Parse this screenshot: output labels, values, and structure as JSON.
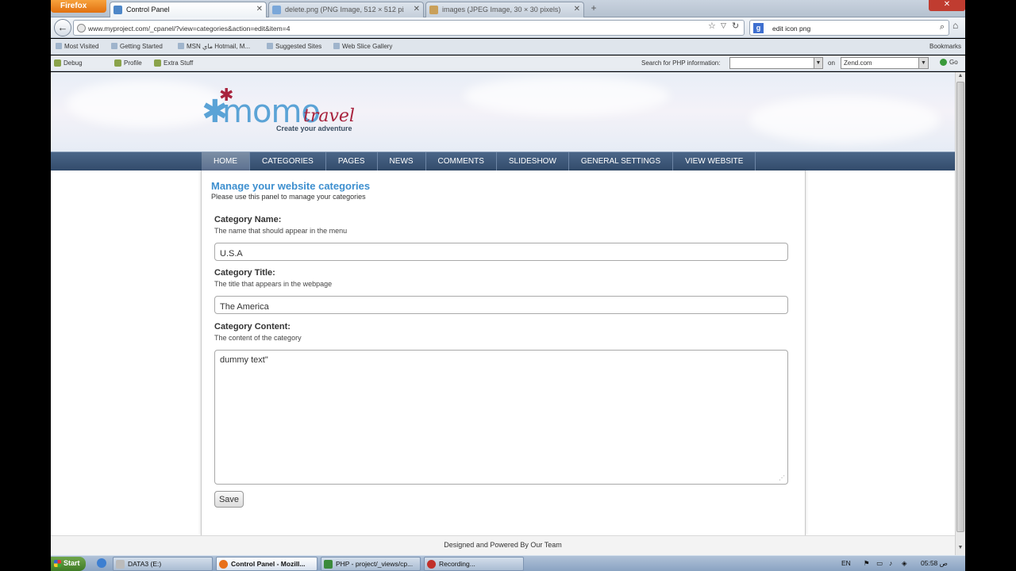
{
  "browser": {
    "menu_button": "Firefox",
    "tabs": [
      {
        "label": "Control Panel",
        "active": true
      },
      {
        "label": "delete.png (PNG Image, 512 × 512 pixels)",
        "active": false
      },
      {
        "label": "images (JPEG Image, 30 × 30 pixels)",
        "active": false
      }
    ],
    "url": "www.myproject.com/_cpanel/?view=categories&action=edit&item=4",
    "search_value": "edit icon png",
    "search_engine_letter": "g",
    "bookmarks": [
      "Most Visited",
      "Getting Started",
      "MSN ماي Hotmail, M...",
      "Suggested Sites",
      "Web Slice Gallery"
    ],
    "bookmarks_menu": "Bookmarks",
    "devbar": {
      "items": [
        "Debug",
        "Profile",
        "Extra Stuff"
      ],
      "php_label": "Search for PHP information:",
      "on_label": "on",
      "site_option": "Zend.com",
      "go_label": "Go"
    }
  },
  "site": {
    "logo_main": "momo",
    "logo_sub": "travel",
    "logo_tagline": "Create your adventure",
    "menu": [
      "HOME",
      "CATEGORIES",
      "PAGES",
      "NEWS",
      "COMMENTS",
      "SLIDESHOW",
      "GENERAL SETTINGS",
      "VIEW WEBSITE"
    ],
    "active_menu": "HOME"
  },
  "panel": {
    "title": "Manage your website categories",
    "subtitle": "Please use this panel to manage your categories",
    "fields": {
      "name": {
        "label": "Category Name:",
        "hint": "The name that should appear in the menu",
        "value": "U.S.A"
      },
      "title": {
        "label": "Category Title:",
        "hint": "The title that appears in the webpage",
        "value": "The America"
      },
      "content": {
        "label": "Category Content:",
        "hint": "The content of the category",
        "value": "dummy text\""
      }
    },
    "save_label": "Save"
  },
  "footer": "Designed and Powered By Our Team",
  "taskbar": {
    "start_label": "Start",
    "tasks": [
      {
        "label": "DATA3 (E:)",
        "active": false
      },
      {
        "label": "Control Panel - Mozill...",
        "active": true
      },
      {
        "label": "PHP - project/_views/cp...",
        "active": false
      },
      {
        "label": "Recording...",
        "active": false
      }
    ],
    "lang": "EN",
    "clock": "05:58 ص"
  },
  "colors": {
    "accent_blue": "#3d8fcf",
    "menu_bg": "#3d577a",
    "logo_blue": "#5ba3d6",
    "logo_red": "#a8233d"
  }
}
